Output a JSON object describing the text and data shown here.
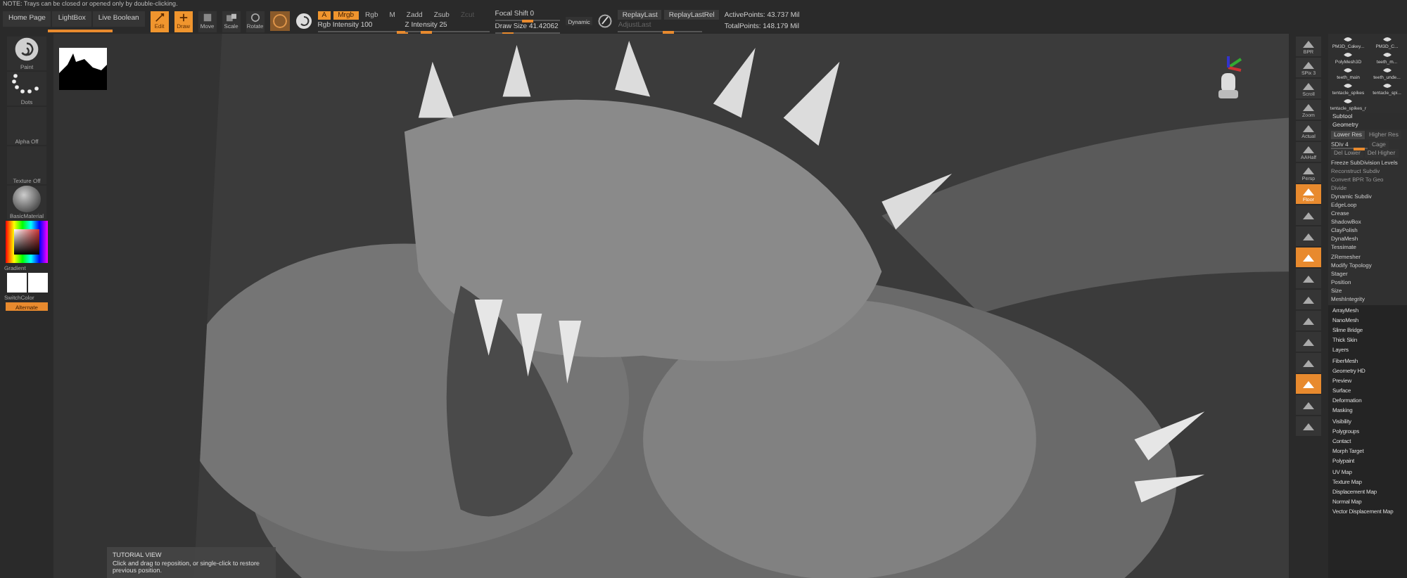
{
  "notice": "NOTE: Trays can be closed or opened only by double-clicking.",
  "top_bar": {
    "nav_buttons": [
      {
        "label": "Home Page"
      },
      {
        "label": "LightBox"
      },
      {
        "label": "Live Boolean"
      }
    ],
    "loading": {
      "level": 1
    },
    "modes": [
      {
        "label": "Edit",
        "selected": true
      },
      {
        "label": "Draw",
        "selected": true
      },
      {
        "label": "Move",
        "selected": false
      },
      {
        "label": "Scale",
        "selected": false
      },
      {
        "label": "Rotate",
        "selected": false
      }
    ],
    "channels": [
      {
        "label": "A",
        "on": true,
        "disabled": false
      },
      {
        "label": "Mrgb",
        "on": true,
        "disabled": false
      },
      {
        "label": "Rgb",
        "on": false,
        "disabled": false
      },
      {
        "label": "M",
        "on": false,
        "disabled": false
      },
      {
        "label": "Zadd",
        "on": false,
        "disabled": false
      },
      {
        "label": "Zsub",
        "on": false,
        "disabled": false
      },
      {
        "label": "Zcut",
        "on": false,
        "disabled": true
      }
    ],
    "intensity_sliders": [
      {
        "label": "Rgb Intensity 100",
        "level": 1
      },
      {
        "label": "Z Intensity 25",
        "level": 0.25
      }
    ],
    "brush_sliders": [
      {
        "label": "Focal Shift 0",
        "level": 0.5
      },
      {
        "label": "Draw Size 41.42062",
        "level": 0.2
      }
    ],
    "dynamic": "Dynamic",
    "replay": [
      "ReplayLast",
      "ReplayLastRel"
    ],
    "adjust": {
      "label": "AdjustLast",
      "level": 0.6,
      "disabled": true
    },
    "stats": [
      "ActivePoints: 43.737 Mil",
      "TotalPoints: 148.179 Mil"
    ]
  },
  "left_tray": [
    {
      "kind": "brush",
      "label": "Paint"
    },
    {
      "kind": "stroke",
      "label": "Dots"
    },
    {
      "kind": "empty",
      "label": "Alpha Off"
    },
    {
      "kind": "empty",
      "label": "Texture Off"
    },
    {
      "kind": "material",
      "label": "BasicMaterial"
    },
    {
      "kind": "color",
      "label": "Gradient"
    },
    {
      "kind": "swatches",
      "label": "SwitchColor"
    },
    {
      "kind": "toggle",
      "label": "Alternate",
      "on": true
    }
  ],
  "viewport": {
    "kind": "picture",
    "tutorial": {
      "title": "TUTORIAL VIEW",
      "text": "Click and drag to reposition, or single-click to restore previous position."
    }
  },
  "right_toolbar": [
    {
      "label": "BPR",
      "selected": false
    },
    {
      "label": "SPix 3",
      "selected": false
    },
    {
      "label": "Scroll",
      "selected": false
    },
    {
      "label": "Zoom",
      "selected": false
    },
    {
      "label": "Actual",
      "selected": false
    },
    {
      "label": "AAHalf",
      "selected": false
    },
    {
      "label": "Persp",
      "selected": false
    },
    {
      "label": "Floor",
      "selected": true
    },
    {
      "selected": false
    },
    {
      "selected": false
    },
    {
      "selected": true
    },
    {
      "selected": false
    },
    {
      "selected": false
    },
    {
      "selected": false
    },
    {
      "selected": false
    },
    {
      "selected": false
    },
    {
      "selected": true
    },
    {
      "selected": false
    },
    {
      "selected": false
    }
  ],
  "subtools": [
    "PM3D_Cakey...",
    "PM3D_C...",
    "PolyMesh3D",
    "teeth_m...",
    "teeth_main",
    "teeth_unde...",
    "tentacle_spikes",
    "tentacle_spi...",
    "tentacle_spikes_r"
  ],
  "panel": {
    "subtool": "Subtool",
    "geometry": "Geometry",
    "res_buttons": [
      {
        "label": "Lower Res",
        "disabled": false
      },
      {
        "label": "Higher Res",
        "disabled": true
      }
    ],
    "sdiv": {
      "label": "SDiv 4",
      "level": 0.75
    },
    "cage": "Cage",
    "del_buttons": [
      {
        "label": "Del Lower",
        "disabled": true
      },
      {
        "label": "Del Higher",
        "disabled": true
      }
    ],
    "items": [
      {
        "label": "Freeze SubDivision Levels",
        "disabled": false
      },
      {
        "label": "Reconstruct Subdiv",
        "disabled": true
      },
      {
        "label": "Convert BPR To Geo",
        "disabled": true
      },
      {
        "label": "Divide",
        "disabled": true
      }
    ],
    "sub_items": [
      "Dynamic Subdiv",
      "EdgeLoop",
      "Crease",
      "ShadowBox",
      "ClayPolish",
      "DynaMesh",
      "Tessimate",
      "ZRemesher",
      "Modify Topology",
      "Stager",
      "Position",
      "Size",
      "MeshIntegrity"
    ],
    "palettes": [
      "ArrayMesh",
      "NanoMesh",
      "Slime Bridge",
      "Thick Skin",
      "Layers",
      "FiberMesh",
      "Geometry HD",
      "Preview",
      "Surface",
      "Deformation",
      "Masking",
      "Visibility",
      "Polygroups",
      "Contact",
      "Morph Target",
      "Polypaint",
      "UV Map",
      "Texture Map",
      "Displacement Map",
      "Normal Map",
      "Vector Displacement Map"
    ]
  }
}
